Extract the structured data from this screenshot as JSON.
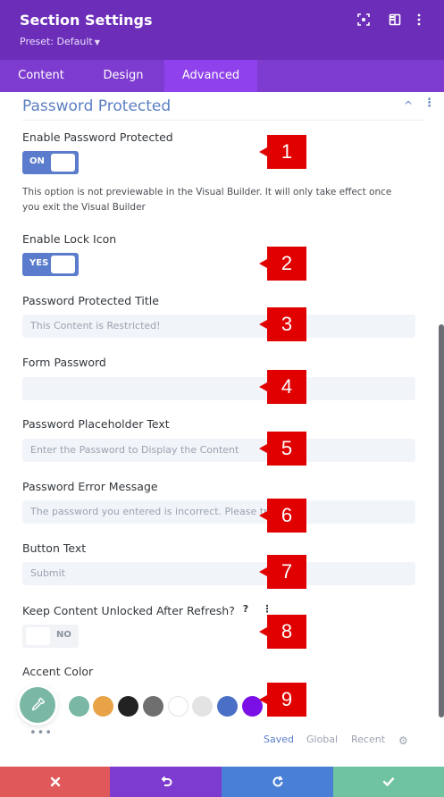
{
  "header": {
    "title": "Section Settings",
    "preset": "Preset: Default",
    "icons": [
      "focus-icon",
      "split-view-icon",
      "more-vertical-icon"
    ]
  },
  "tabs": [
    {
      "label": "Content",
      "active": false
    },
    {
      "label": "Design",
      "active": false
    },
    {
      "label": "Advanced",
      "active": true
    }
  ],
  "section": {
    "title": "Password Protected"
  },
  "fields": {
    "enable_password_protected": {
      "label": "Enable Password Protected",
      "toggle": "ON"
    },
    "note": "This option is not previewable in the Visual Builder. It will only take effect once you exit the Visual Builder",
    "enable_lock_icon": {
      "label": "Enable Lock Icon",
      "toggle": "YES"
    },
    "protected_title": {
      "label": "Password Protected Title",
      "placeholder": "This Content is Restricted!"
    },
    "form_password": {
      "label": "Form Password",
      "placeholder": ""
    },
    "placeholder_text": {
      "label": "Password Placeholder Text",
      "placeholder": "Enter the Password to Display the Content"
    },
    "error_message": {
      "label": "Password Error Message",
      "placeholder": "The password you entered is incorrect. Please try again."
    },
    "button_text": {
      "label": "Button Text",
      "placeholder": "Submit"
    },
    "keep_unlocked": {
      "label": "Keep Content Unlocked After Refresh?",
      "toggle": "NO",
      "help": "?",
      "menu": "⋮"
    },
    "accent_color": {
      "label": "Accent Color"
    }
  },
  "badges": [
    "1",
    "2",
    "3",
    "4",
    "5",
    "6",
    "7",
    "8",
    "9"
  ],
  "colors": {
    "header_bg": "#6c2eb9",
    "tab_bg": "#7e3bd0",
    "tab_active_bg": "#8f42ec",
    "accent": "#5b7ccc",
    "badge": "#e00000",
    "picker": "#7ab8a5",
    "swatches": [
      "#7ab8a5",
      "#e8a347",
      "#222222",
      "#6f6f6f",
      "#ffffff",
      "#e3e3e3",
      "#4a6fc7",
      "#7a10e6"
    ]
  },
  "swatch_tabs": [
    {
      "label": "Saved",
      "active": true
    },
    {
      "label": "Global",
      "active": false
    },
    {
      "label": "Recent",
      "active": false
    }
  ],
  "more": "•••",
  "footer": {
    "buttons": [
      {
        "name": "cancel",
        "icon": "close-icon",
        "color": "#e0585a"
      },
      {
        "name": "undo",
        "icon": "undo-icon",
        "color": "#7e3bd0"
      },
      {
        "name": "redo",
        "icon": "redo-icon",
        "color": "#4a7fd6"
      },
      {
        "name": "save",
        "icon": "check-icon",
        "color": "#6fc3a0"
      }
    ]
  }
}
